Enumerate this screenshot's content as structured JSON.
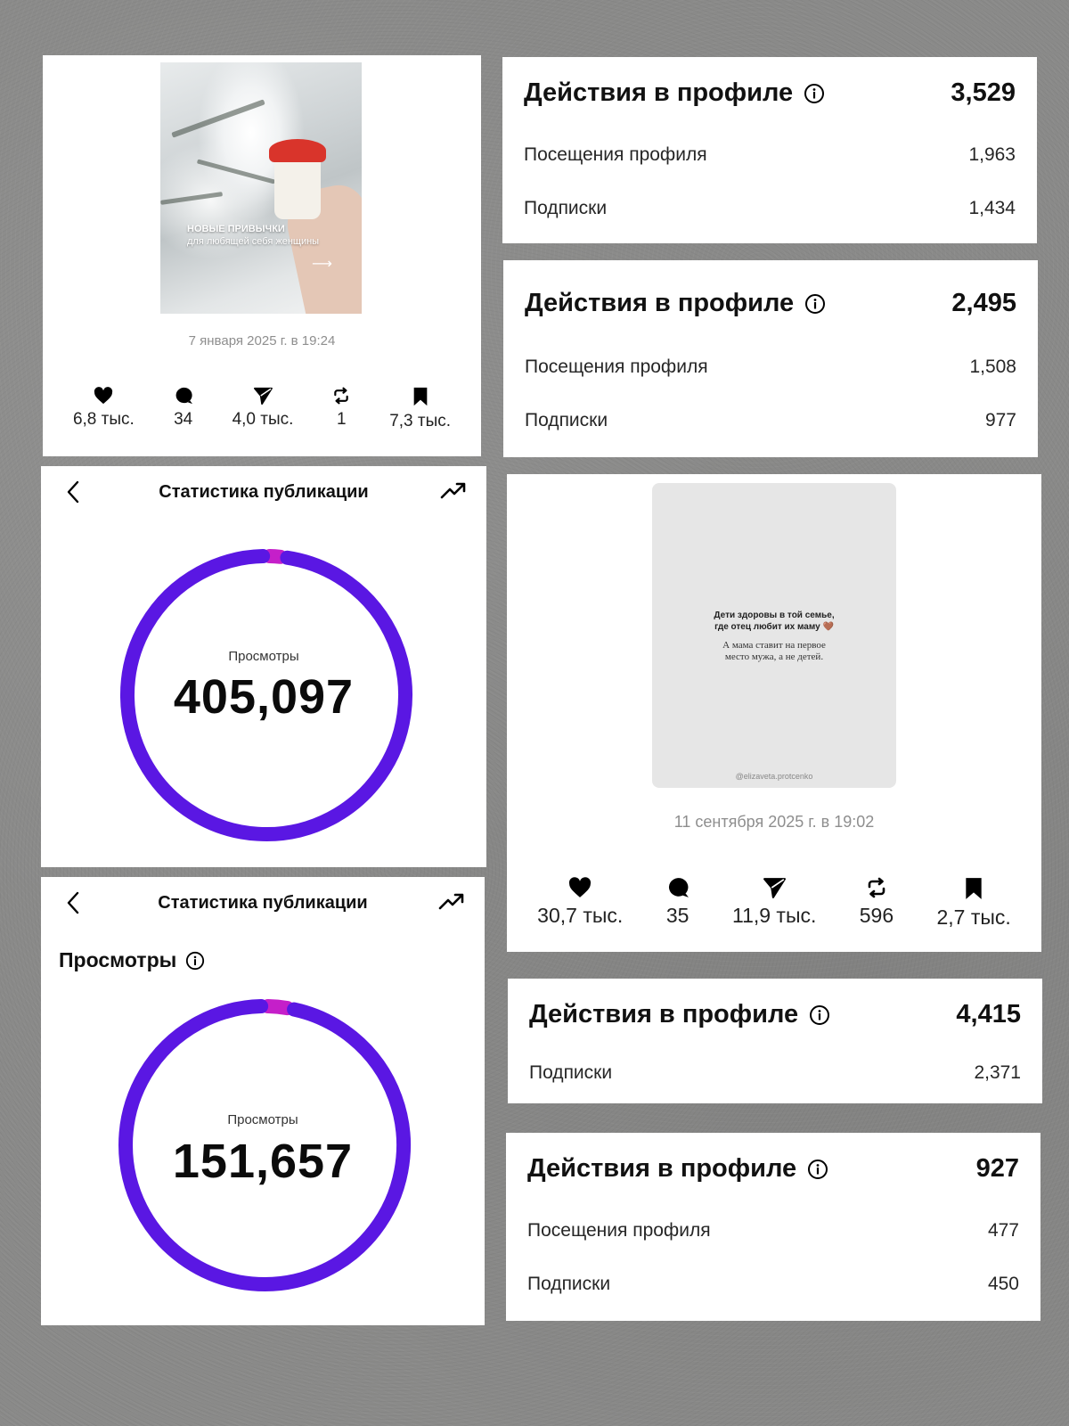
{
  "post1": {
    "caption_line1": "НОВЫЕ ПРИВЫЧКИ",
    "caption_line2": "для любящей себя женщины",
    "date": "7 января 2025 г. в 19:24",
    "metrics": [
      {
        "icon": "heart-icon",
        "value": "6,8 тыс."
      },
      {
        "icon": "comment-icon",
        "value": "34"
      },
      {
        "icon": "send-icon",
        "value": "4,0 тыс."
      },
      {
        "icon": "repost-icon",
        "value": "1"
      },
      {
        "icon": "bookmark-icon",
        "value": "7,3 тыс."
      }
    ]
  },
  "post2": {
    "quote_line1": "Дети здоровы в той семье,",
    "quote_line2": "где отец любит их маму 🤎",
    "quote_line3": "А мама ставит на первое",
    "quote_line4": "место мужа, а не детей.",
    "handle": "@elizaveta.protcenko",
    "date": "11 сентября 2025 г. в 19:02",
    "metrics": [
      {
        "icon": "heart-icon",
        "value": "30,7 тыс."
      },
      {
        "icon": "comment-icon",
        "value": "35"
      },
      {
        "icon": "send-icon",
        "value": "11,9 тыс."
      },
      {
        "icon": "repost-icon",
        "value": "596"
      },
      {
        "icon": "bookmark-icon",
        "value": "2,7 тыс."
      }
    ]
  },
  "profile_actions": [
    {
      "title": "Действия в профиле",
      "total": "3,529",
      "visits_label": "Посещения профиля",
      "visits": "1,963",
      "follows_label": "Подписки",
      "follows": "1,434"
    },
    {
      "title": "Действия в профиле",
      "total": "2,495",
      "visits_label": "Посещения профиля",
      "visits": "1,508",
      "follows_label": "Подписки",
      "follows": "977"
    },
    {
      "title": "Действия в профиле",
      "total": "4,415",
      "follows_label": "Подписки",
      "follows": "2,371"
    },
    {
      "title": "Действия в профиле",
      "total": "927",
      "visits_label": "Посещения профиля",
      "visits": "477",
      "follows_label": "Подписки",
      "follows": "450"
    }
  ],
  "stats": [
    {
      "title": "Статистика публикации",
      "ring_label": "Просмотры",
      "views": "405,097",
      "accent_fraction": 0.02
    },
    {
      "title": "Статистика публикации",
      "section": "Просмотры",
      "ring_label": "Просмотры",
      "views": "151,657",
      "accent_fraction": 0.03
    }
  ],
  "colors": {
    "ring_main": "#5a17e3",
    "ring_accent": "#c51fc9",
    "background": "#8a8a89"
  }
}
